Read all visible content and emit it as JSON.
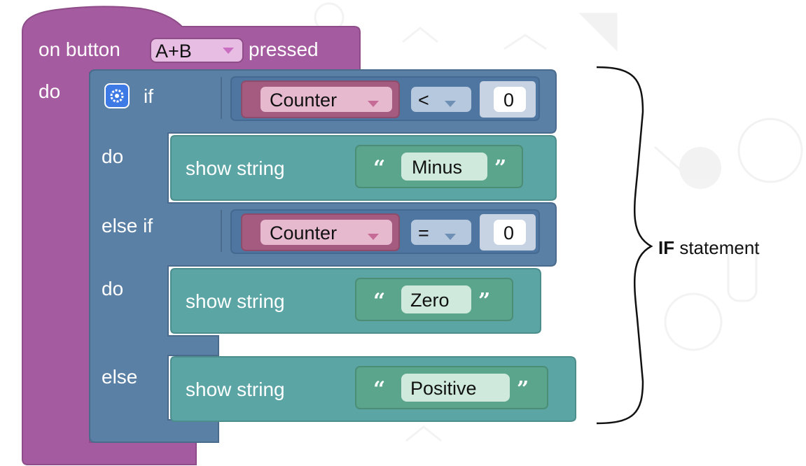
{
  "event": {
    "prefix": "on button",
    "button": "A+B",
    "suffix": "pressed",
    "do": "do",
    "color": "#a55b9f"
  },
  "if_block": {
    "if": "if",
    "do1": "do",
    "else_if": "else if",
    "do2": "do",
    "else": "else",
    "color": "#5b80a5",
    "condition1": {
      "variable": "Counter",
      "operator": "<",
      "value": "0"
    },
    "condition2": {
      "variable": "Counter",
      "operator": "=",
      "value": "0"
    }
  },
  "show_blocks": {
    "command": "show string",
    "open_quote": "“",
    "close_quote": "”",
    "strings": [
      "Minus",
      "Zero",
      "Positive"
    ],
    "color": "#5ba5a5"
  },
  "annotation": {
    "bold": "IF",
    "rest": " statement"
  },
  "colors": {
    "variable": "#a55b80",
    "compare": "#5b80a5",
    "text_block": "#5ba58c"
  },
  "icons": [
    "gear-icon",
    "dropdown-arrow-icon",
    "curly-brace-icon"
  ]
}
